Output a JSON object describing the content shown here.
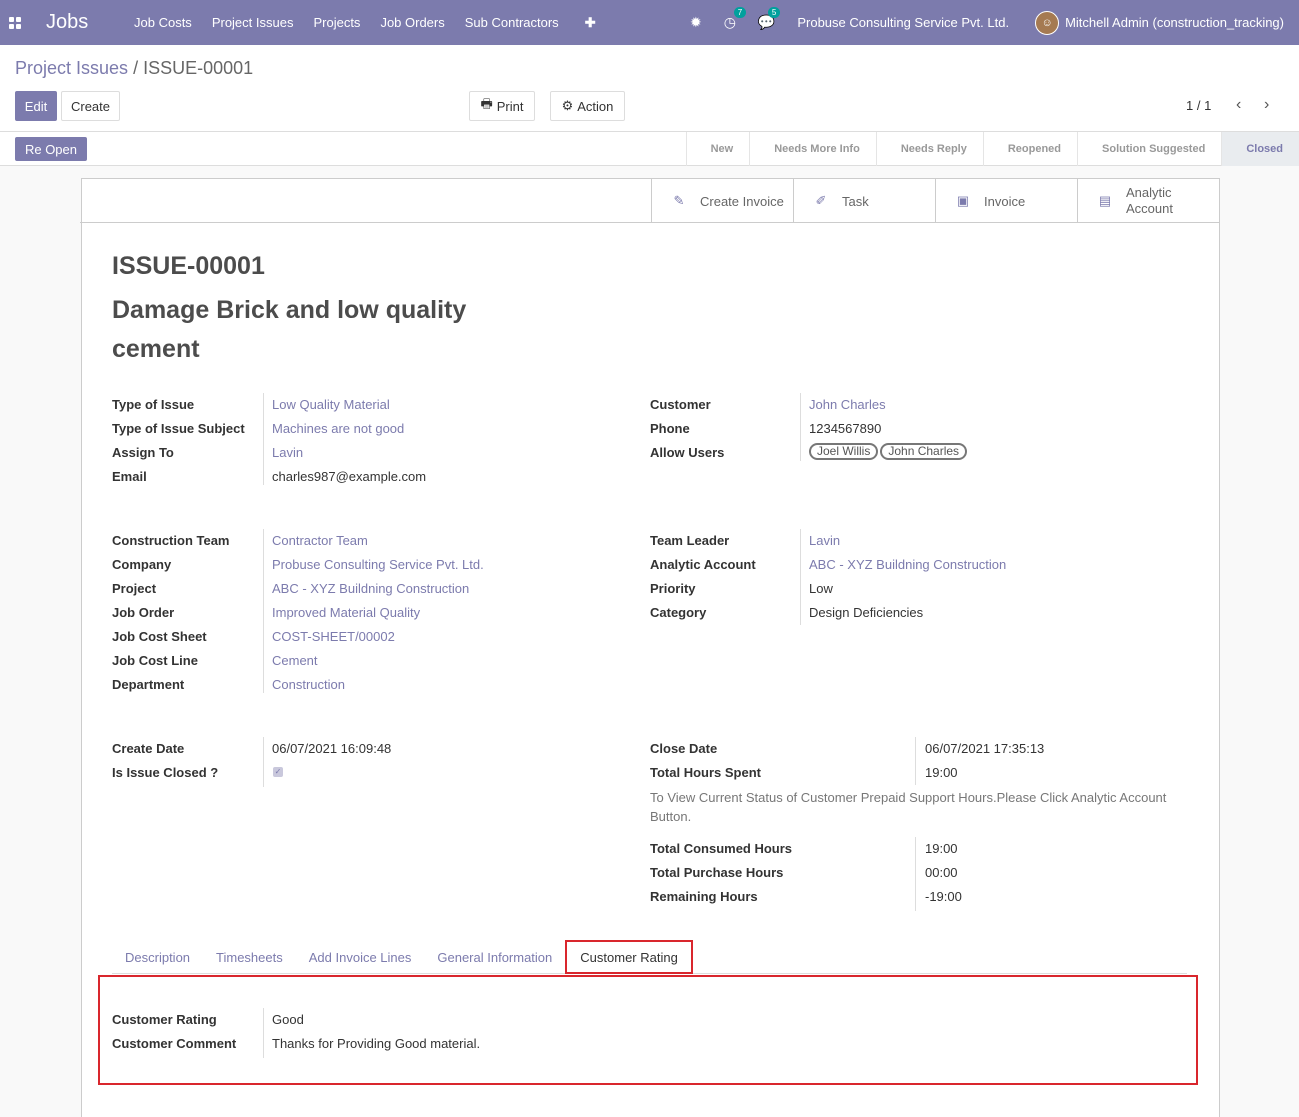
{
  "nav": {
    "brand": "Jobs",
    "menu": [
      "Job Costs",
      "Project Issues",
      "Projects",
      "Job Orders",
      "Sub Contractors"
    ],
    "activity_count": "7",
    "messages_count": "5",
    "company": "Probuse Consulting Service Pvt. Ltd.",
    "user": "Mitchell Admin (construction_tracking)"
  },
  "breadcrumb": {
    "parent": "Project Issues",
    "sep": "/",
    "current": "ISSUE-00001"
  },
  "toolbar": {
    "edit": "Edit",
    "create": "Create",
    "print": "Print",
    "action": "Action",
    "pager": "1 / 1"
  },
  "status": {
    "reopen": "Re Open",
    "stages": [
      "New",
      "Needs More Info",
      "Needs Reply",
      "Reopened",
      "Solution Suggested",
      "Closed"
    ],
    "active_stage": "Closed"
  },
  "buttonbox": {
    "create_invoice": "Create Invoice",
    "task": "Task",
    "invoice": "Invoice",
    "analytic_1": "Analytic",
    "analytic_2": "Account"
  },
  "record": {
    "number": "ISSUE-00001",
    "name_line1": "Damage Brick and low quality",
    "name_line2": "cement"
  },
  "fields": {
    "type_of_issue": {
      "label": "Type of Issue",
      "value": "Low Quality Material"
    },
    "type_of_issue_subject": {
      "label": "Type of Issue Subject",
      "value": "Machines are not good"
    },
    "assign_to": {
      "label": "Assign To",
      "value": "Lavin"
    },
    "email": {
      "label": "Email",
      "value": "charles987@example.com"
    },
    "customer": {
      "label": "Customer",
      "value": "John Charles"
    },
    "phone": {
      "label": "Phone",
      "value": "1234567890"
    },
    "allow_users": {
      "label": "Allow Users",
      "tags": [
        "Joel Willis",
        "John Charles"
      ]
    },
    "construction_team": {
      "label": "Construction Team",
      "value": "Contractor Team"
    },
    "company": {
      "label": "Company",
      "value": "Probuse Consulting Service Pvt. Ltd."
    },
    "project": {
      "label": "Project",
      "value": "ABC - XYZ Buildning Construction"
    },
    "job_order": {
      "label": "Job Order",
      "value": "Improved Material Quality"
    },
    "job_cost_sheet": {
      "label": "Job Cost Sheet",
      "value": "COST-SHEET/00002"
    },
    "job_cost_line": {
      "label": "Job Cost Line",
      "value": "Cement"
    },
    "department": {
      "label": "Department",
      "value": "Construction"
    },
    "team_leader": {
      "label": "Team Leader",
      "value": "Lavin"
    },
    "analytic_account": {
      "label": "Analytic Account",
      "value": "ABC - XYZ Buildning Construction"
    },
    "priority": {
      "label": "Priority",
      "value": "Low"
    },
    "category": {
      "label": "Category",
      "value": "Design Deficiencies"
    },
    "create_date": {
      "label": "Create Date",
      "value": "06/07/2021 16:09:48"
    },
    "is_issue_closed": {
      "label": "Is Issue Closed ?",
      "checked": true
    },
    "close_date": {
      "label": "Close Date",
      "value": "06/07/2021 17:35:13"
    },
    "total_hours_spent": {
      "label": "Total Hours Spent",
      "value": "19:00"
    },
    "help_text": "To View Current Status of Customer Prepaid Support Hours.Please Click Analytic Account Button.",
    "total_consumed_hours": {
      "label": "Total Consumed Hours",
      "value": "19:00"
    },
    "total_purchase_hours": {
      "label": "Total Purchase Hours",
      "value": "00:00"
    },
    "remaining_hours": {
      "label": "Remaining Hours",
      "value": "-19:00"
    }
  },
  "tabs": [
    "Description",
    "Timesheets",
    "Add Invoice Lines",
    "General Information",
    "Customer Rating"
  ],
  "active_tab": "Customer Rating",
  "rating": {
    "customer_rating": {
      "label": "Customer Rating",
      "value": "Good"
    },
    "customer_comment": {
      "label": "Customer Comment",
      "value": "Thanks for Providing Good material."
    }
  },
  "colors": {
    "brand": "#7c7bad",
    "highlight": "#d9262d",
    "badge": "#00a09d"
  }
}
